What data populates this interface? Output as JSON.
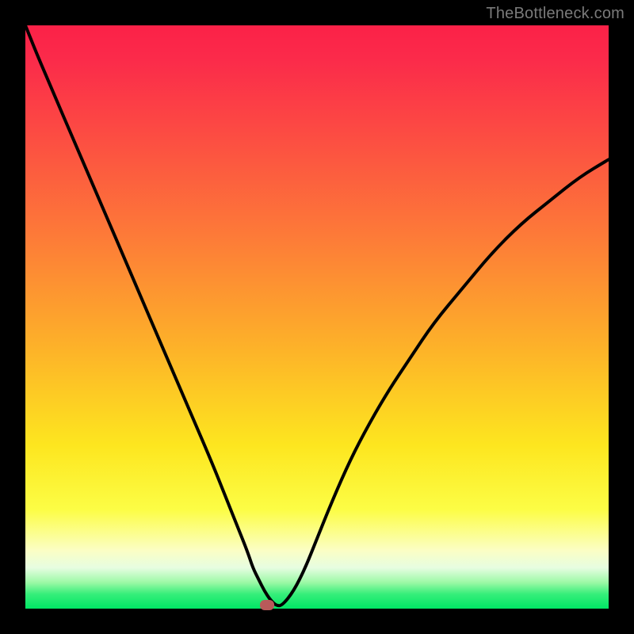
{
  "watermark": "TheBottleneck.com",
  "colors": {
    "frame": "#000000",
    "curve": "#000000",
    "marker": "#b95a5a",
    "gradient_top": "#fb2148",
    "gradient_bottom": "#00e765"
  },
  "chart_data": {
    "type": "line",
    "title": "",
    "xlabel": "",
    "ylabel": "",
    "xlim": [
      0,
      100
    ],
    "ylim": [
      0,
      100
    ],
    "x": [
      0,
      2,
      5,
      8,
      11,
      14,
      17,
      20,
      23,
      26,
      29,
      32,
      34,
      36,
      38,
      39,
      40,
      41,
      42,
      43,
      44,
      46,
      48,
      50,
      52,
      55,
      58,
      62,
      66,
      70,
      75,
      80,
      85,
      90,
      95,
      100
    ],
    "y": [
      100,
      95,
      88,
      81,
      74,
      67,
      60,
      53,
      46,
      39,
      32,
      25,
      20,
      15,
      10,
      7,
      5,
      3,
      1.5,
      0.5,
      0.5,
      3,
      7,
      12,
      17,
      24,
      30,
      37,
      43,
      49,
      55,
      61,
      66,
      70,
      74,
      77
    ],
    "flat_min_x_range": [
      38,
      43
    ],
    "marker": {
      "x": 41.5,
      "y": 0
    },
    "annotations": []
  }
}
